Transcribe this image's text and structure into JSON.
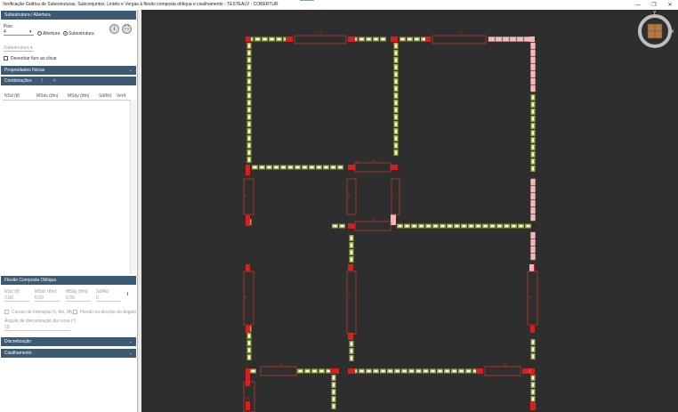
{
  "window": {
    "title": "Verificação Gráfica de Subestruturas, Subconjuntos, Lintéis e Vergas à flexão composta oblíqua e cisalhamento - TESTEALV - COBERTUR",
    "controls": {
      "minimize": "—",
      "maximize": "❐",
      "close": "✕"
    }
  },
  "sidebar": {
    "section_subestrutura": "Subestrutura / Abertura",
    "piso_label": "Piso",
    "piso_value": "4",
    "radio_abertura": "Abertura",
    "radio_subestrutura": "Subestrutura",
    "radio_selected": "Subestrutura",
    "info_button": "i",
    "expand_button": "⛶",
    "subestrutura_select": "Subestrutura",
    "desenhar_furo_label": "Desenhar furo ao clicar",
    "section_propriedades": "Propriedades físicas",
    "combinacoes_tab": "Combinações",
    "combinacoes_tools": [
      "↧",
      "✛"
    ],
    "table_headers": [
      "NSd (tf)",
      "MSdx (tfm)",
      "MSdy (tfm)",
      "Sd/Rd",
      "Verif."
    ],
    "section_flexao": "Flexão Composta Oblíqua",
    "flexao_fields": [
      {
        "label": "NSd (tf)",
        "value": "0,00"
      },
      {
        "label": "MSdx (tfm)",
        "value": "0,00"
      },
      {
        "label": "MSdy (tfm)",
        "value": "0,00"
      },
      {
        "label": "Sd/Rd",
        "value": "0"
      }
    ],
    "flexao_info": "i",
    "check_curvas": "Curvas de interação N, Mx, My",
    "check_flexao_angulo": "Flexão na direção do ângulo",
    "angulo_label": "Ângulo de discretização da curva (º)",
    "angulo_value": "10",
    "section_discretizacao": "Discretização",
    "section_cisalhamento": "Cisalhamento"
  },
  "canvas": {
    "background": "#2e2e2e",
    "colors": {
      "outline": "#c0392b",
      "filled": "#d62020",
      "block": "#9aa43a",
      "hole": "#ffffff",
      "empty": "#f2b8b8",
      "cube": "#b07a4a"
    },
    "view_cube": {
      "top_label": "Y",
      "right_label": "X"
    },
    "element_labels": [
      "1",
      "2",
      "3",
      "4",
      "5",
      "6",
      "7",
      "8",
      "9",
      "10",
      "11",
      "12",
      "13",
      "14"
    ]
  }
}
